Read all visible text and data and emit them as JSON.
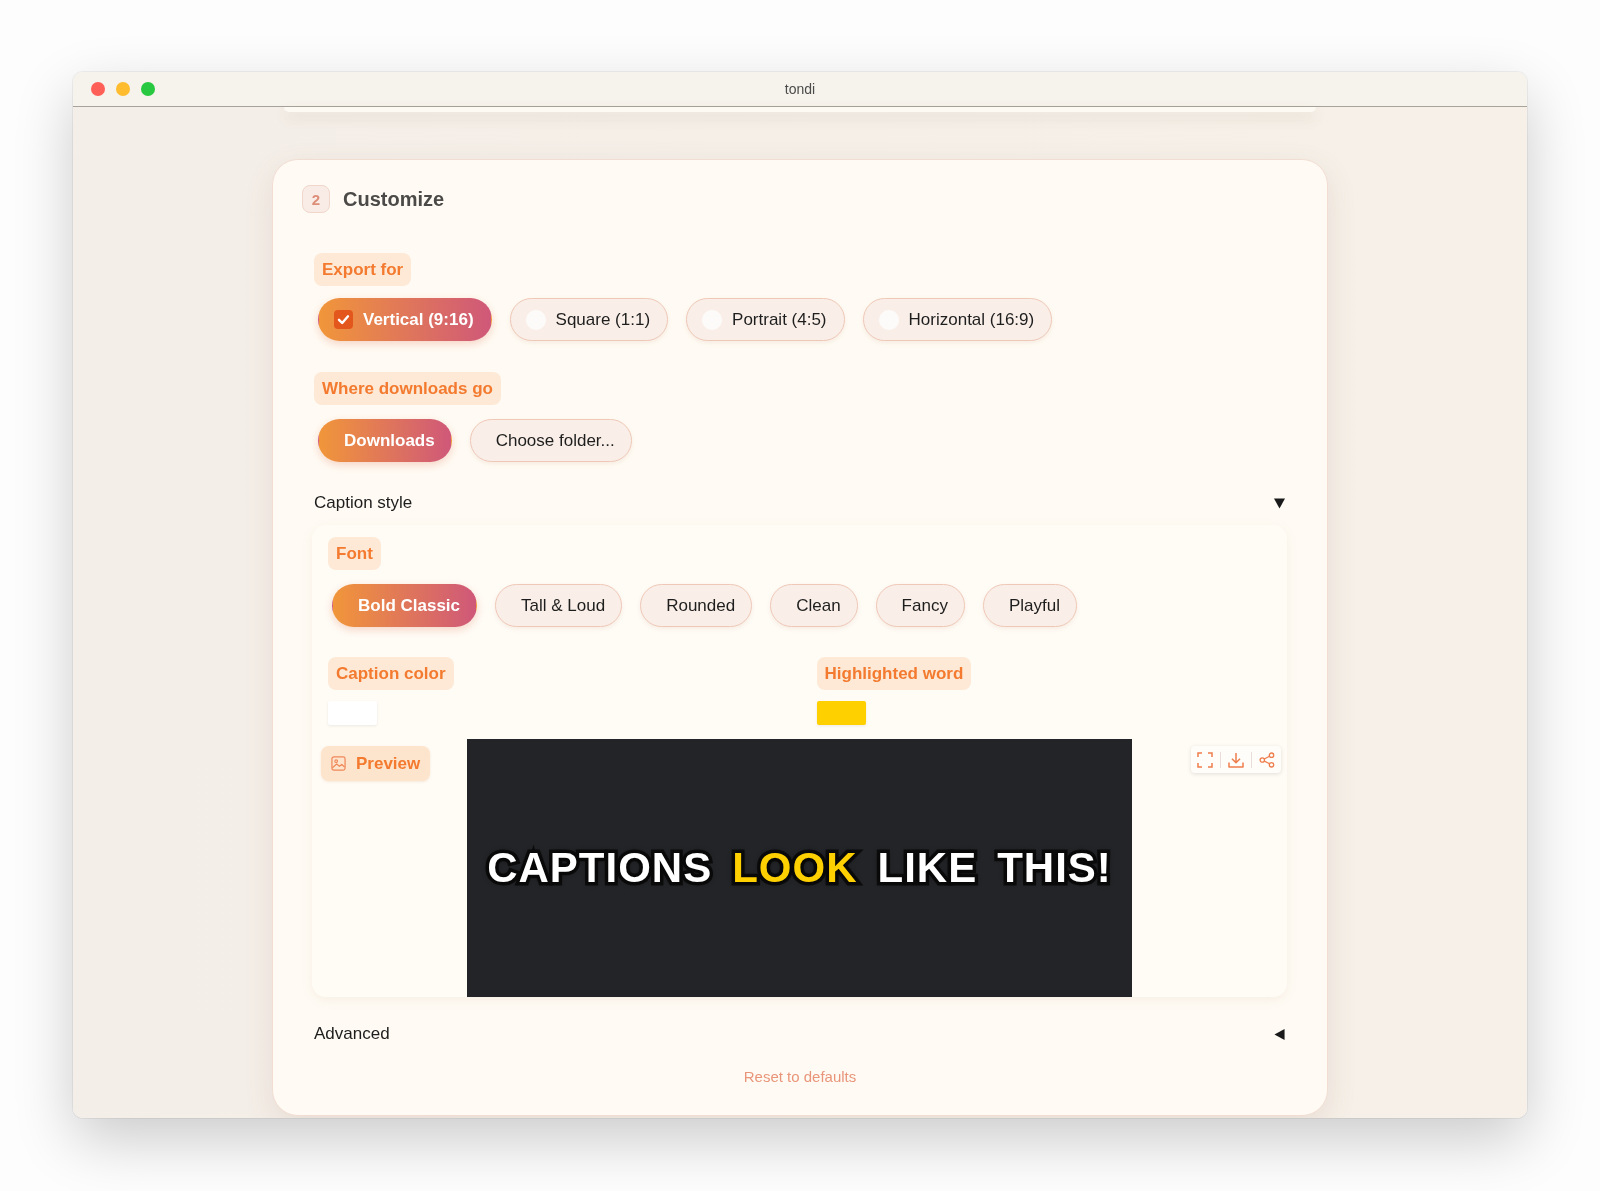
{
  "window": {
    "title": "tondi"
  },
  "step": {
    "number": "2",
    "title": "Customize"
  },
  "export": {
    "label": "Export for",
    "options": [
      {
        "label": "Vertical (9:16)",
        "selected": true
      },
      {
        "label": "Square (1:1)",
        "selected": false
      },
      {
        "label": "Portrait (4:5)",
        "selected": false
      },
      {
        "label": "Horizontal (16:9)",
        "selected": false
      }
    ]
  },
  "downloads": {
    "label": "Where downloads go",
    "options": [
      {
        "label": "Downloads",
        "selected": true
      },
      {
        "label": "Choose folder...",
        "selected": false
      }
    ]
  },
  "caption_style": {
    "title": "Caption style",
    "expanded": true,
    "font": {
      "label": "Font",
      "options": [
        {
          "label": "Bold Classic",
          "selected": true
        },
        {
          "label": "Tall & Loud",
          "selected": false
        },
        {
          "label": "Rounded",
          "selected": false
        },
        {
          "label": "Clean",
          "selected": false
        },
        {
          "label": "Fancy",
          "selected": false
        },
        {
          "label": "Playful",
          "selected": false
        }
      ]
    },
    "caption_color": {
      "label": "Caption color",
      "color": "#ffffff"
    },
    "highlight_color": {
      "label": "Highlighted word",
      "color": "#ffd000"
    },
    "preview": {
      "label": "Preview",
      "words": [
        {
          "text": "CAPTIONS",
          "highlighted": false
        },
        {
          "text": "LOOK",
          "highlighted": true
        },
        {
          "text": "LIKE",
          "highlighted": false
        },
        {
          "text": "THIS!",
          "highlighted": false
        }
      ]
    }
  },
  "advanced": {
    "title": "Advanced",
    "expanded": false
  },
  "reset": {
    "label": "Reset to defaults"
  }
}
